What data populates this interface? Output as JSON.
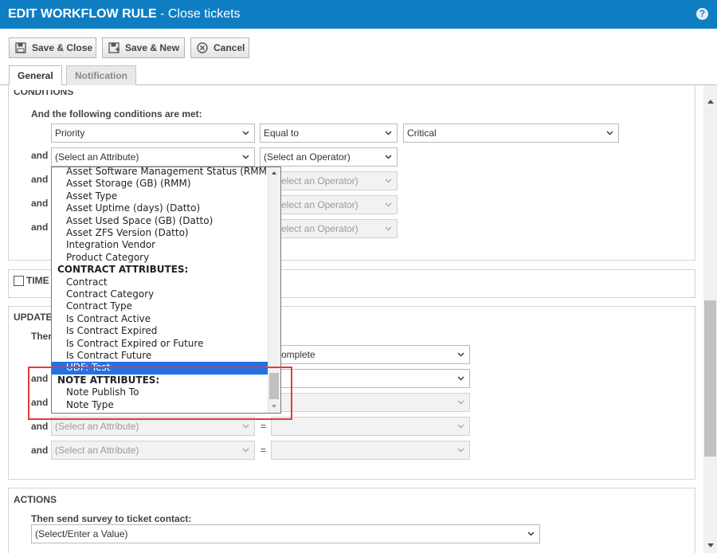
{
  "window": {
    "title_main": "EDIT WORKFLOW RULE",
    "title_sub": " - Close tickets",
    "help_icon": "?"
  },
  "toolbar": {
    "save_close": "Save & Close",
    "save_new": "Save & New",
    "cancel": "Cancel"
  },
  "tabs": [
    "General",
    "Notification"
  ],
  "conditions": {
    "section_title": "CONDITIONS",
    "intro": "And the following conditions are met:",
    "row1": {
      "attribute": "Priority",
      "operator": "Equal to",
      "value": "Critical"
    },
    "and_label": "and",
    "row2": {
      "attribute": "(Select an Attribute)",
      "operator": "(Select an Operator)"
    },
    "disabled_operator": "(Select an Operator)",
    "disabled_operator_visible": "elect an Operator)"
  },
  "time": {
    "label": "TIME"
  },
  "updates": {
    "section_title": "UPDATE",
    "intro_fragment": "Then",
    "status_value_visible": "omplete",
    "attribute_placeholder": "(Select an Attribute)",
    "equals": "="
  },
  "actions": {
    "section_title": "ACTIONS",
    "survey_label": "Then send survey to ticket contact:",
    "survey_value": "(Select/Enter a Value)"
  },
  "dropdown": {
    "items": [
      {
        "label": "Asset Software Management Status (RMM)",
        "type": "item"
      },
      {
        "label": "Asset Storage (GB) (RMM)",
        "type": "item"
      },
      {
        "label": "Asset Type",
        "type": "item"
      },
      {
        "label": "Asset Uptime (days) (Datto)",
        "type": "item"
      },
      {
        "label": "Asset Used Space (GB) (Datto)",
        "type": "item"
      },
      {
        "label": "Asset ZFS Version (Datto)",
        "type": "item"
      },
      {
        "label": "Integration Vendor",
        "type": "item"
      },
      {
        "label": "Product Category",
        "type": "item"
      },
      {
        "label": "CONTRACT ATTRIBUTES:",
        "type": "group"
      },
      {
        "label": "Contract",
        "type": "item"
      },
      {
        "label": "Contract Category",
        "type": "item"
      },
      {
        "label": "Contract Type",
        "type": "item"
      },
      {
        "label": "Is Contract Active",
        "type": "item"
      },
      {
        "label": "Is Contract Expired",
        "type": "item"
      },
      {
        "label": "Is Contract Expired or Future",
        "type": "item"
      },
      {
        "label": "Is Contract Future",
        "type": "item"
      },
      {
        "label": "UDF: Test",
        "type": "selected"
      },
      {
        "label": "NOTE ATTRIBUTES:",
        "type": "group"
      },
      {
        "label": "Note Publish To",
        "type": "item"
      },
      {
        "label": "Note Type",
        "type": "item"
      }
    ]
  },
  "colors": {
    "title_bar": "#0f7dc2",
    "selected_item": "#1e73e8",
    "highlight_box": "#e23b3b"
  }
}
